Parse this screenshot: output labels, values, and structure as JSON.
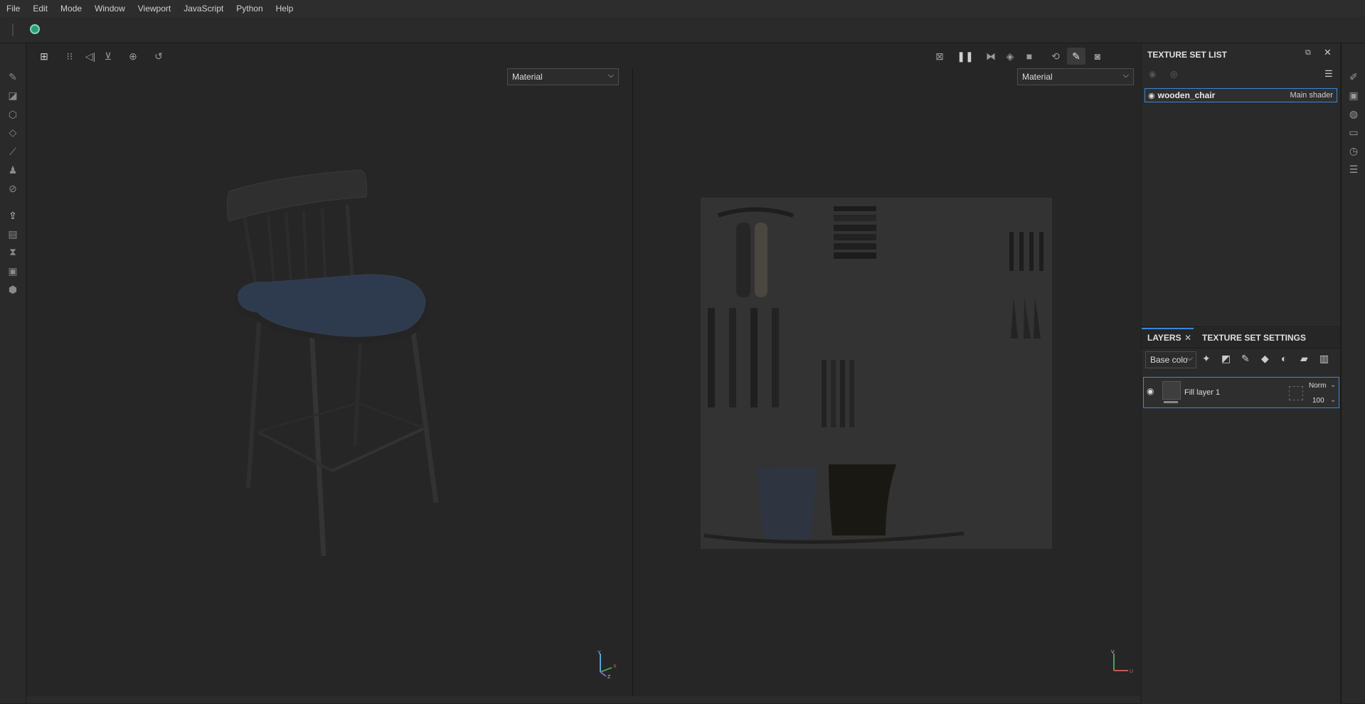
{
  "menu": [
    "File",
    "Edit",
    "Mode",
    "Window",
    "Viewport",
    "JavaScript",
    "Python",
    "Help"
  ],
  "viewport": {
    "left_select": "Material",
    "right_select": "Material",
    "axis_left": {
      "y": "Y",
      "x": "X",
      "z": "Z"
    },
    "axis_right": {
      "v": "V",
      "u": "U"
    }
  },
  "texture_set_list": {
    "title": "TEXTURE SET LIST",
    "item_name": "wooden_chair",
    "item_shader": "Main shader"
  },
  "layers": {
    "tab_layers": "LAYERS",
    "tab_settings": "TEXTURE SET SETTINGS",
    "channel": "Base colo",
    "layer_name": "Fill layer 1",
    "blend_mode": "Norm",
    "opacity": "100"
  },
  "colors": {
    "accent": "#3a86d8",
    "logo": "#2e9e7a",
    "seat": "#2e3a4e"
  }
}
